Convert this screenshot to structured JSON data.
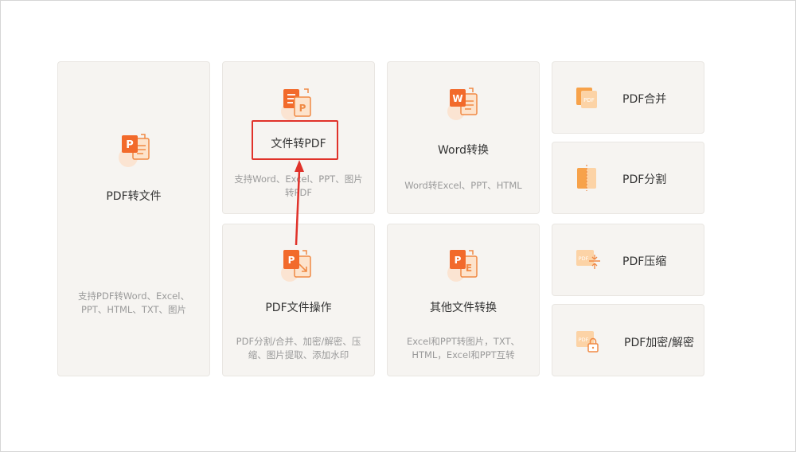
{
  "cards": {
    "pdf_to_file": {
      "title": "PDF转文件",
      "desc": "支持PDF转Word、Excel、PPT、HTML、TXT、图片"
    },
    "file_to_pdf": {
      "title": "文件转PDF",
      "desc": "支持Word、Excel、PPT、图片转PDF"
    },
    "word_convert": {
      "title": "Word转换",
      "desc": "Word转Excel、PPT、HTML"
    },
    "pdf_operations": {
      "title": "PDF文件操作",
      "desc": "PDF分割/合并、加密/解密、压缩、图片提取、添加水印"
    },
    "other_convert": {
      "title": "其他文件转换",
      "desc": "Excel和PPT转图片，TXT、HTML，Excel和PPT互转"
    },
    "pdf_merge": {
      "title": "PDF合并"
    },
    "pdf_split": {
      "title": "PDF分割"
    },
    "pdf_compress": {
      "title": "PDF压缩"
    },
    "pdf_encrypt": {
      "title": "PDF加密/解密"
    }
  },
  "icons": {
    "ppt_letter": "P",
    "word_letter": "W",
    "excel_letter": "E",
    "pdf_tag": "PDF"
  },
  "colors": {
    "accent_orange": "#f26a2b",
    "accent_light": "#f7b27a",
    "highlight_red": "#e0322a",
    "card_bg": "#f6f4f1"
  }
}
